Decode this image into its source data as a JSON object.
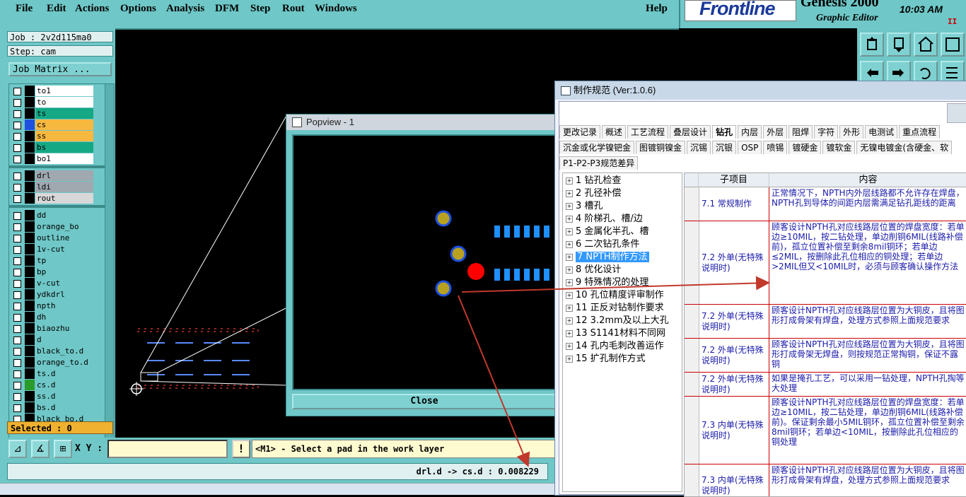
{
  "menu": [
    "File",
    "Edit",
    "Actions",
    "Options",
    "Analysis",
    "DFM",
    "Step",
    "Rout",
    "Windows",
    "Help"
  ],
  "brand": {
    "logo": "Frontline",
    "product": "Genesis 2000",
    "subtitle": "Graphic Editor",
    "clock": "10:03 AM",
    "pause": "II"
  },
  "job": {
    "job_label": "Job : 2v2d115ma0",
    "step_label": "Step: cam",
    "matrix_button": "Job Matrix ..."
  },
  "layers_top": [
    {
      "name": "to1",
      "color": "#ffffff",
      "mark": "pencil-icon"
    },
    {
      "name": "to",
      "color": "#ffffff",
      "mark": "pencil-icon"
    },
    {
      "name": "ts",
      "color": "#14a884",
      "mark": ""
    },
    {
      "name": "cs",
      "color": "#f7b840",
      "mark": ""
    },
    {
      "name": "ss",
      "color": "#f7b840",
      "mark": ""
    },
    {
      "name": "bs",
      "color": "#14a884",
      "mark": ""
    },
    {
      "name": "bo1",
      "color": "#ffffff",
      "mark": "pencil-icon"
    }
  ],
  "layers_mid": [
    {
      "name": "drl",
      "color": "#a0a8b0"
    },
    {
      "name": "ldi",
      "color": "#a0a8b0"
    },
    {
      "name": "rout",
      "color": "#d8d8d8"
    }
  ],
  "layers_misc": [
    "dd",
    "orange_bo",
    "outline",
    "1v-cut",
    "tp",
    "bp",
    "v-cut",
    "ydkdrl",
    "npth",
    "dh",
    "biaozhu",
    "d",
    "black_to.d",
    "orange_to.d",
    "ts.d",
    "cs.d",
    "ss.d",
    "bs.d",
    "black_bo.d"
  ],
  "selected": "Selected : 0",
  "cmd": {
    "xy_label": "X Y :",
    "xy_value": "",
    "bang": "!",
    "prompt": "<M1> - Select a pad in the work layer"
  },
  "status": "drl.d -> cs.d : 0.008229",
  "popview": {
    "title": "Popview - 1",
    "close": "Close"
  },
  "spec": {
    "title": "制作规范 (Ver:1.0.6)",
    "tabs_row1": [
      "更改记录",
      "概述",
      "工艺流程",
      "叠层设计",
      "钻孔",
      "内层",
      "外层",
      "阻焊",
      "字符",
      "外形",
      "电测试",
      "重点流程"
    ],
    "tabs_row2": [
      "沉金或化学镍钯金",
      "图镀铜镍金",
      "沉锡",
      "沉银",
      "OSP",
      "喷锡",
      "镀硬金",
      "镀软金",
      "无镍电镀金(含硬金、软"
    ],
    "tabs_row3": [
      "P1-P2-P3规范差异"
    ],
    "active_tab": "钻孔",
    "tree": [
      "1 钻孔检查",
      "2 孔径补偿",
      "3 槽孔",
      "4 阶梯孔、槽/边",
      "5 金属化半孔、槽",
      "6 二次钻孔条件",
      "7 NPTH制作方法",
      "8 优化设计",
      "9 特殊情况的处理",
      "10 孔位精度评审制作",
      "11 正反对钻制作要求",
      "12 3.2mm及以上大孔",
      "13 S1141材料不同网",
      "14 孔内毛刺改善运作",
      "15 扩孔制作方式"
    ],
    "tree_selected": 6,
    "grid_headers": [
      "子项目",
      "内容"
    ],
    "rows": [
      {
        "sub": "7.1 常规制作",
        "content": "正常情况下，NPTH内外层线路都不允许存在焊盘，NPTH孔到导体的间距内层需满足钻孔距线的距离"
      },
      {
        "sub": "7.2 外单(无特殊说明时)",
        "content": "顾客设计NPTH孔对应线路层位置的焊盘宽度：若单边≥10MIL，按二钻处理，单边削铜6MIL(线路补偿前)，孤立位置补偿至剩余8mil铜环；若单边≤2MIL，按删除此孔位相应的铜处理；若单边>2MIL但又<10MIL时，必须与顾客确认操作方法"
      },
      {
        "sub": "7.2 外单(无特殊说明时)",
        "content": "顾客设计NPTH孔对应线路层位置为大铜皮，且将图形打成骨架有焊盘，处理方式参照上面规范要求"
      },
      {
        "sub": "7.2 外单(无特殊说明时)",
        "content": "顾客设计NPTH孔对应线路层位置为大铜皮，且将图形打成骨架无焊盘，则按规范正常掏铜，保证不露铜"
      },
      {
        "sub": "7.2 外单(无特殊说明时)",
        "content": "如果是掩孔工艺，可以采用一钻处理，NPTH孔掏等大处理"
      },
      {
        "sub": "7.3 内单(无特殊说明时)",
        "content": "顾客设计NPTH孔对应线路层位置的焊盘宽度：若单边≥10MIL，按二钻处理，单边削铜6MIL(线路补偿前)。保证剩余最小5MIL铜环，孤立位置补偿至剩余8mil铜环；若单边<10MIL，按删除此孔位相应的铜处理"
      },
      {
        "sub": "7.3 内单(无特殊说明时)",
        "content": "顾客设计NPTH孔对应线路层位置为大铜皮，且将图形打成骨架有焊盘，处理方式参照上面规范要求"
      }
    ]
  },
  "colors": {
    "panel": "#6fc7c7",
    "arrow": "#c0392b",
    "pad": "#1e50e0",
    "pad_center": "#b8a020",
    "red_pad": "#ff0000",
    "cyan_strip": "#1e90ff"
  }
}
